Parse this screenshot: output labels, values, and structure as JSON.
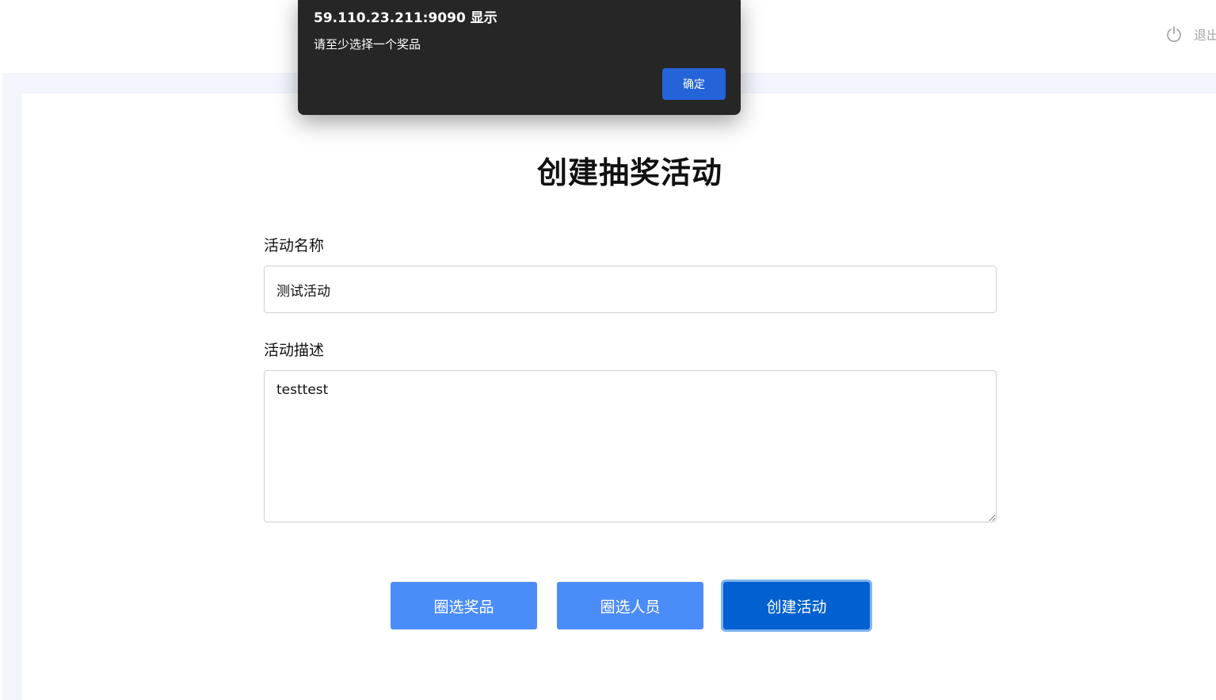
{
  "header": {
    "logout_label": "退出",
    "logout_icon": "power-icon"
  },
  "form": {
    "title": "创建抽奖活动",
    "name_label": "活动名称",
    "name_value": "测试活动",
    "desc_label": "活动描述",
    "desc_value": "testtest",
    "buttons": {
      "select_prize": "圈选奖品",
      "select_people": "圈选人员",
      "create": "创建活动"
    }
  },
  "dialog": {
    "title": "59.110.23.211:9090 显示",
    "message": "请至少选择一个奖品",
    "ok_label": "确定"
  },
  "colors": {
    "primary_button": "#4b8df8",
    "create_button": "#0260d0",
    "dialog_background": "#262626",
    "dialog_button": "#2563d8",
    "page_background": "#f2f5fc"
  }
}
